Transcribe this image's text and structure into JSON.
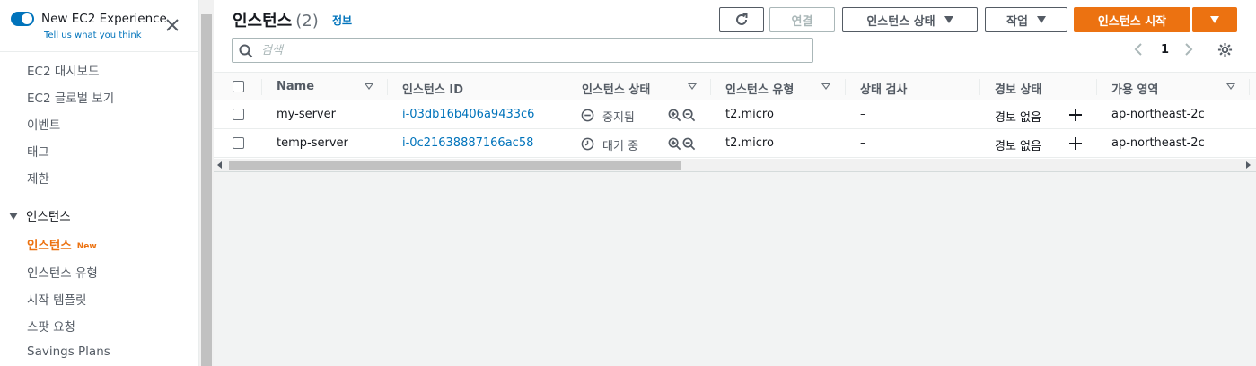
{
  "sidebar": {
    "experience_title": "New EC2 Experience",
    "experience_sub": "Tell us what you think",
    "items": [
      "EC2 대시보드",
      "EC2 글로벌 보기",
      "이벤트",
      "태그",
      "제한"
    ],
    "section": "인스턴스",
    "active_item": "인스턴스",
    "active_badge": "New",
    "section_items": [
      "인스턴스 유형",
      "시작 템플릿",
      "스팟 요청",
      "Savings Plans"
    ]
  },
  "header": {
    "title": "인스턴스",
    "count": "(2)",
    "info": "정보",
    "connect": "연결",
    "instance_state": "인스턴스 상태",
    "actions": "작업",
    "launch": "인스턴스 시작"
  },
  "search": {
    "placeholder": "검색"
  },
  "pagination": {
    "page": "1"
  },
  "table": {
    "columns": [
      "Name",
      "인스턴스 ID",
      "인스턴스 상태",
      "인스턴스 유형",
      "상태 검사",
      "경보 상태",
      "가용 영역"
    ],
    "rows": [
      {
        "name": "my-server",
        "id": "i-03db16b406a9433c6",
        "state": "중지됨",
        "type": "t2.micro",
        "check": "–",
        "alarm": "경보 없음",
        "az": "ap-northeast-2c"
      },
      {
        "name": "temp-server",
        "id": "i-0c21638887166ac58",
        "state": "대기 중",
        "type": "t2.micro",
        "check": "–",
        "alarm": "경보 없음",
        "az": "ap-northeast-2c"
      }
    ]
  },
  "colors": {
    "accent": "#ec7211",
    "link": "#0073bb"
  }
}
